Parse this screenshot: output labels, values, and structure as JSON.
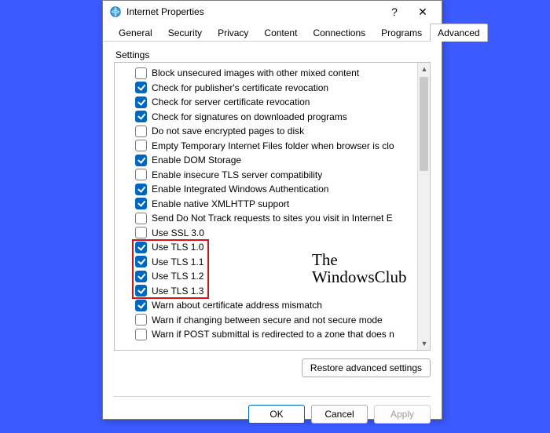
{
  "window": {
    "title": "Internet Properties",
    "help_glyph": "?",
    "close_glyph": "✕"
  },
  "tabs": [
    {
      "label": "General",
      "active": false
    },
    {
      "label": "Security",
      "active": false
    },
    {
      "label": "Privacy",
      "active": false
    },
    {
      "label": "Content",
      "active": false
    },
    {
      "label": "Connections",
      "active": false
    },
    {
      "label": "Programs",
      "active": false
    },
    {
      "label": "Advanced",
      "active": true
    }
  ],
  "section_label": "Settings",
  "settings": [
    {
      "checked": false,
      "label": "Block unsecured images with other mixed content"
    },
    {
      "checked": true,
      "label": "Check for publisher's certificate revocation"
    },
    {
      "checked": true,
      "label": "Check for server certificate revocation"
    },
    {
      "checked": true,
      "label": "Check for signatures on downloaded programs"
    },
    {
      "checked": false,
      "label": "Do not save encrypted pages to disk"
    },
    {
      "checked": false,
      "label": "Empty Temporary Internet Files folder when browser is clo"
    },
    {
      "checked": true,
      "label": "Enable DOM Storage"
    },
    {
      "checked": false,
      "label": "Enable insecure TLS server compatibility"
    },
    {
      "checked": true,
      "label": "Enable Integrated Windows Authentication"
    },
    {
      "checked": true,
      "label": "Enable native XMLHTTP support"
    },
    {
      "checked": false,
      "label": "Send Do Not Track requests to sites you visit in Internet E"
    },
    {
      "checked": false,
      "label": "Use SSL 3.0"
    },
    {
      "checked": true,
      "label": "Use TLS 1.0",
      "highlighted": true
    },
    {
      "checked": true,
      "label": "Use TLS 1.1",
      "highlighted": true
    },
    {
      "checked": true,
      "label": "Use TLS 1.2",
      "highlighted": true
    },
    {
      "checked": true,
      "label": "Use TLS 1.3",
      "highlighted": true
    },
    {
      "checked": true,
      "label": "Warn about certificate address mismatch"
    },
    {
      "checked": false,
      "label": "Warn if changing between secure and not secure mode"
    },
    {
      "checked": false,
      "label": "Warn if POST submittal is redirected to a zone that does n"
    }
  ],
  "watermark": {
    "line1": "The",
    "line2": "WindowsClub"
  },
  "buttons": {
    "restore": "Restore advanced settings",
    "ok": "OK",
    "cancel": "Cancel",
    "apply": "Apply"
  },
  "highlight": {
    "from_index": 12,
    "to_index": 15
  }
}
